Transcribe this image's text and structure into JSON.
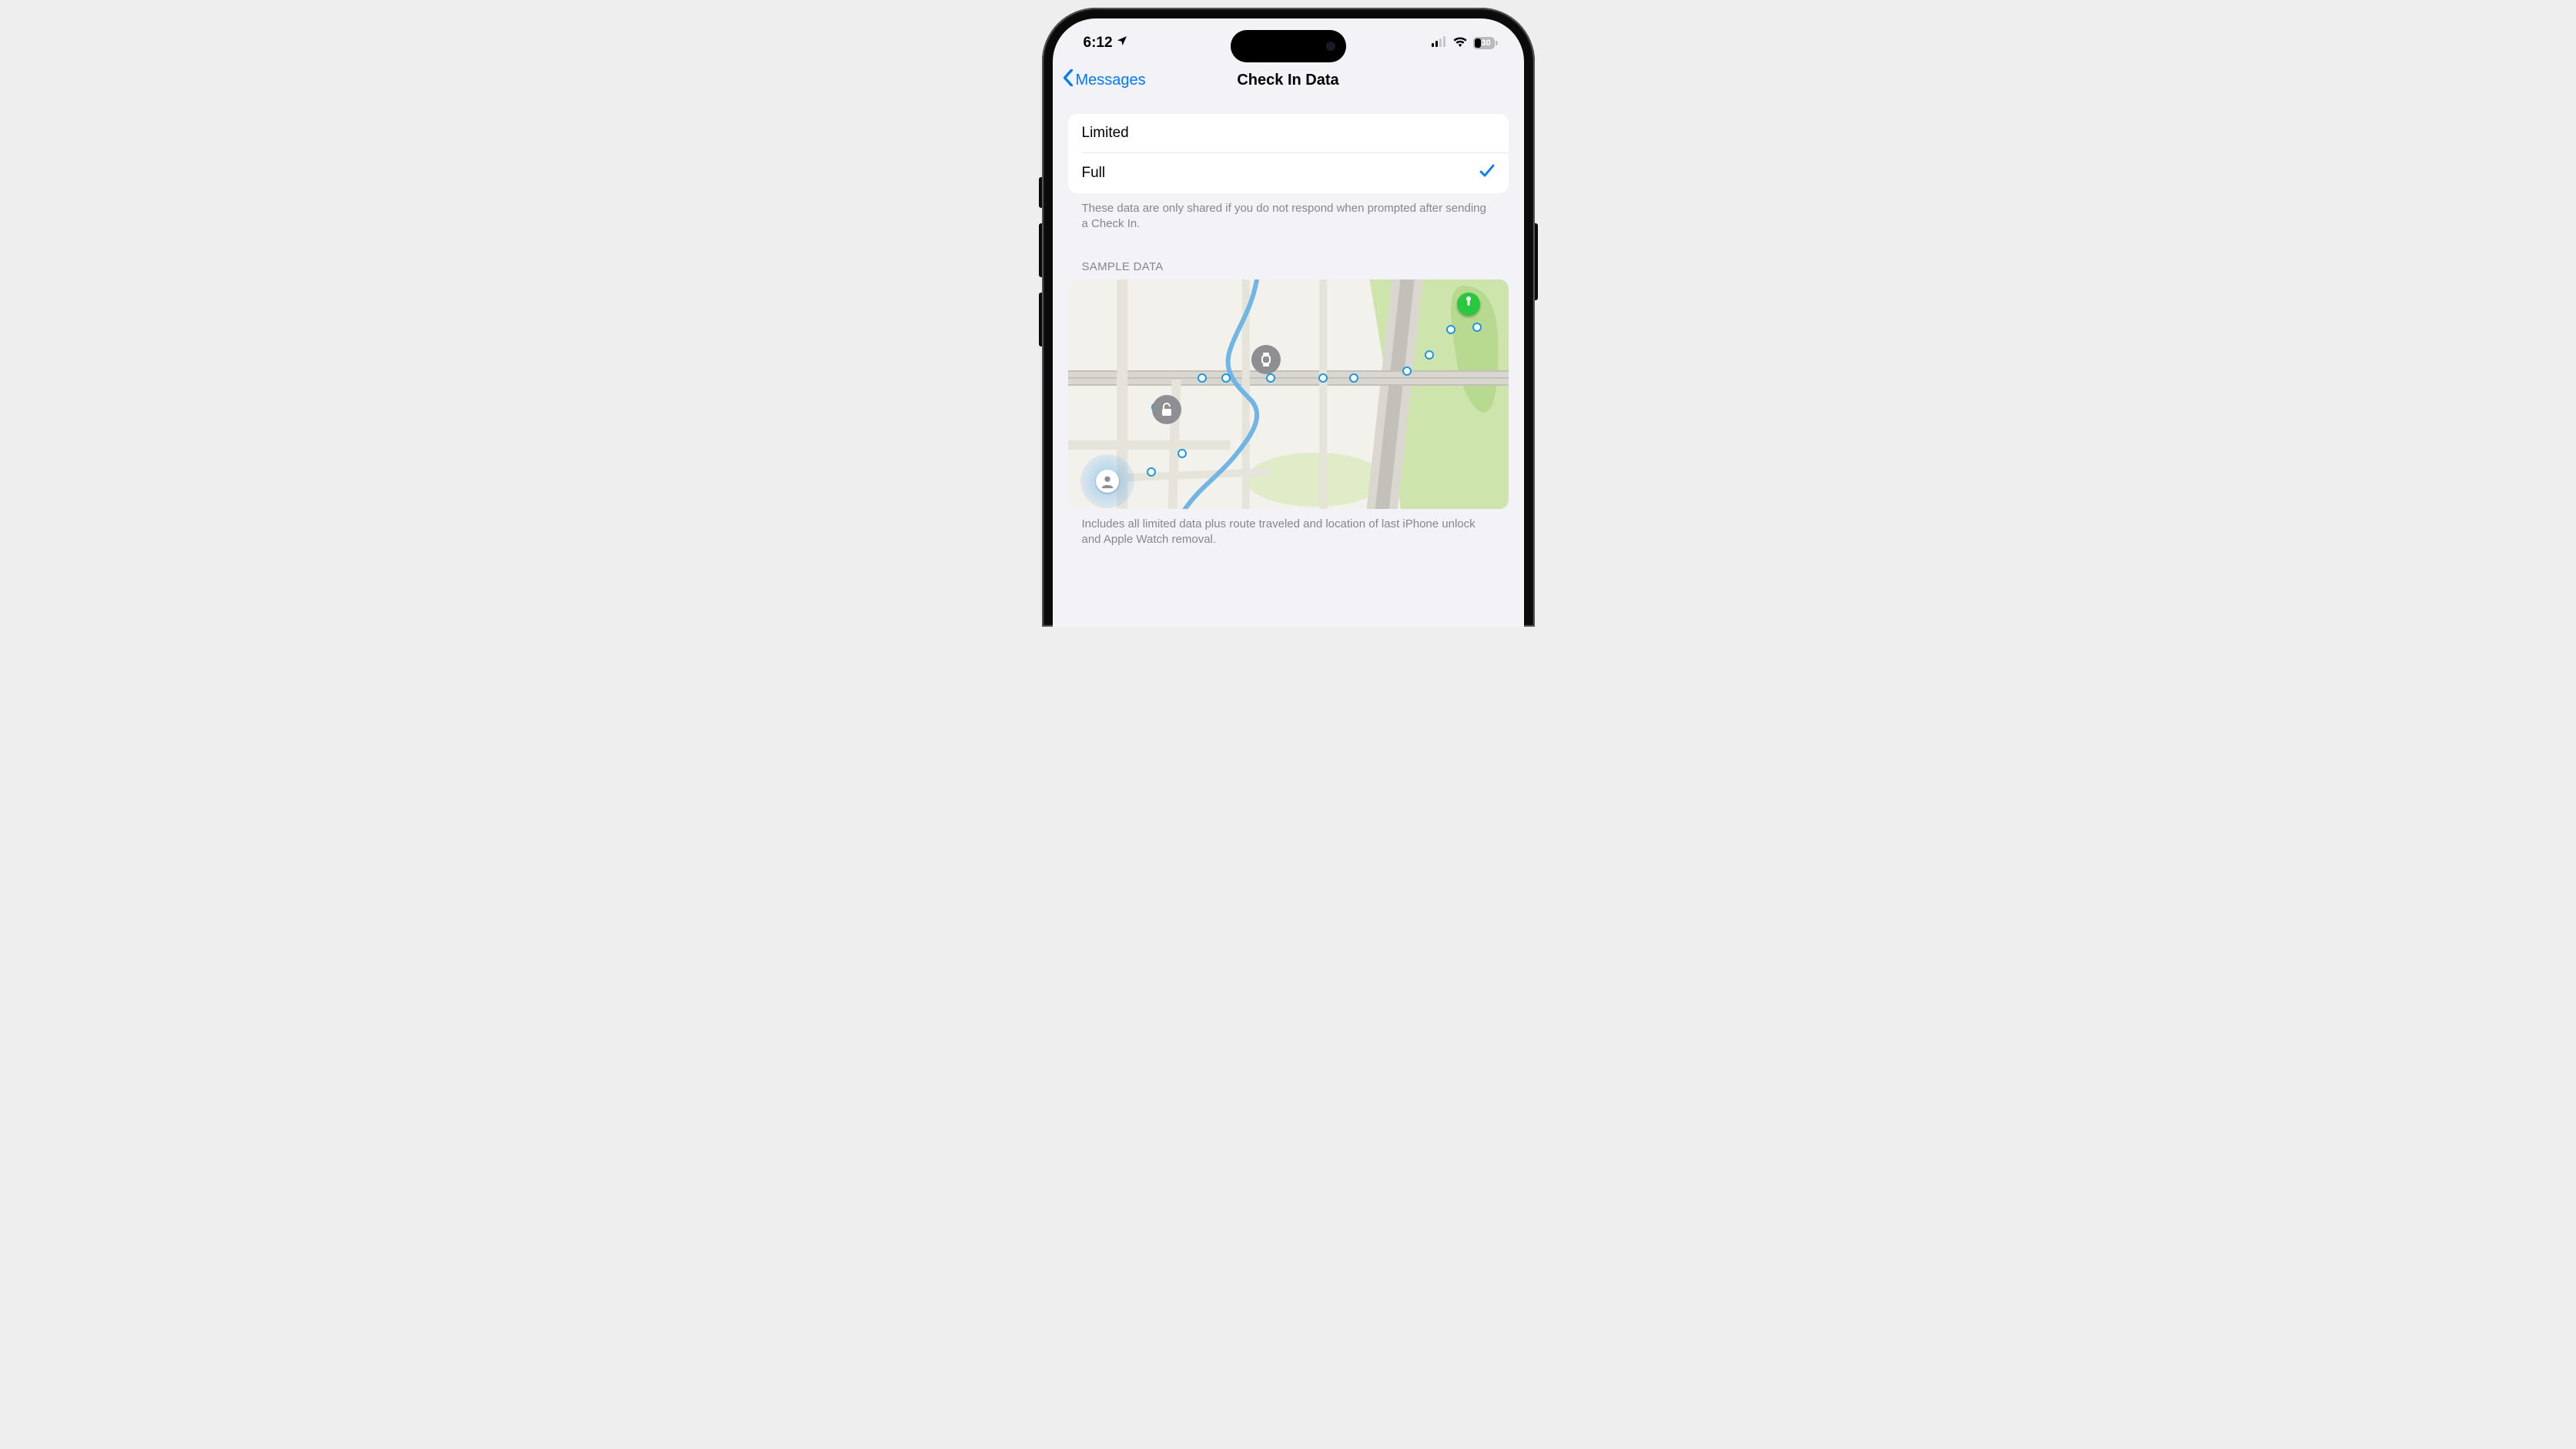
{
  "status": {
    "time": "6:12",
    "battery_level": "30"
  },
  "nav": {
    "back_label": "Messages",
    "title": "Check In Data"
  },
  "options": {
    "limited_label": "Limited",
    "full_label": "Full",
    "selected": "full",
    "footer": "These data are only shared if you do not respond when prompted after sending a Check In."
  },
  "sample": {
    "header": "SAMPLE DATA",
    "footer": "Includes all limited data plus route traveled and location of last iPhone unlock and Apple Watch removal."
  }
}
